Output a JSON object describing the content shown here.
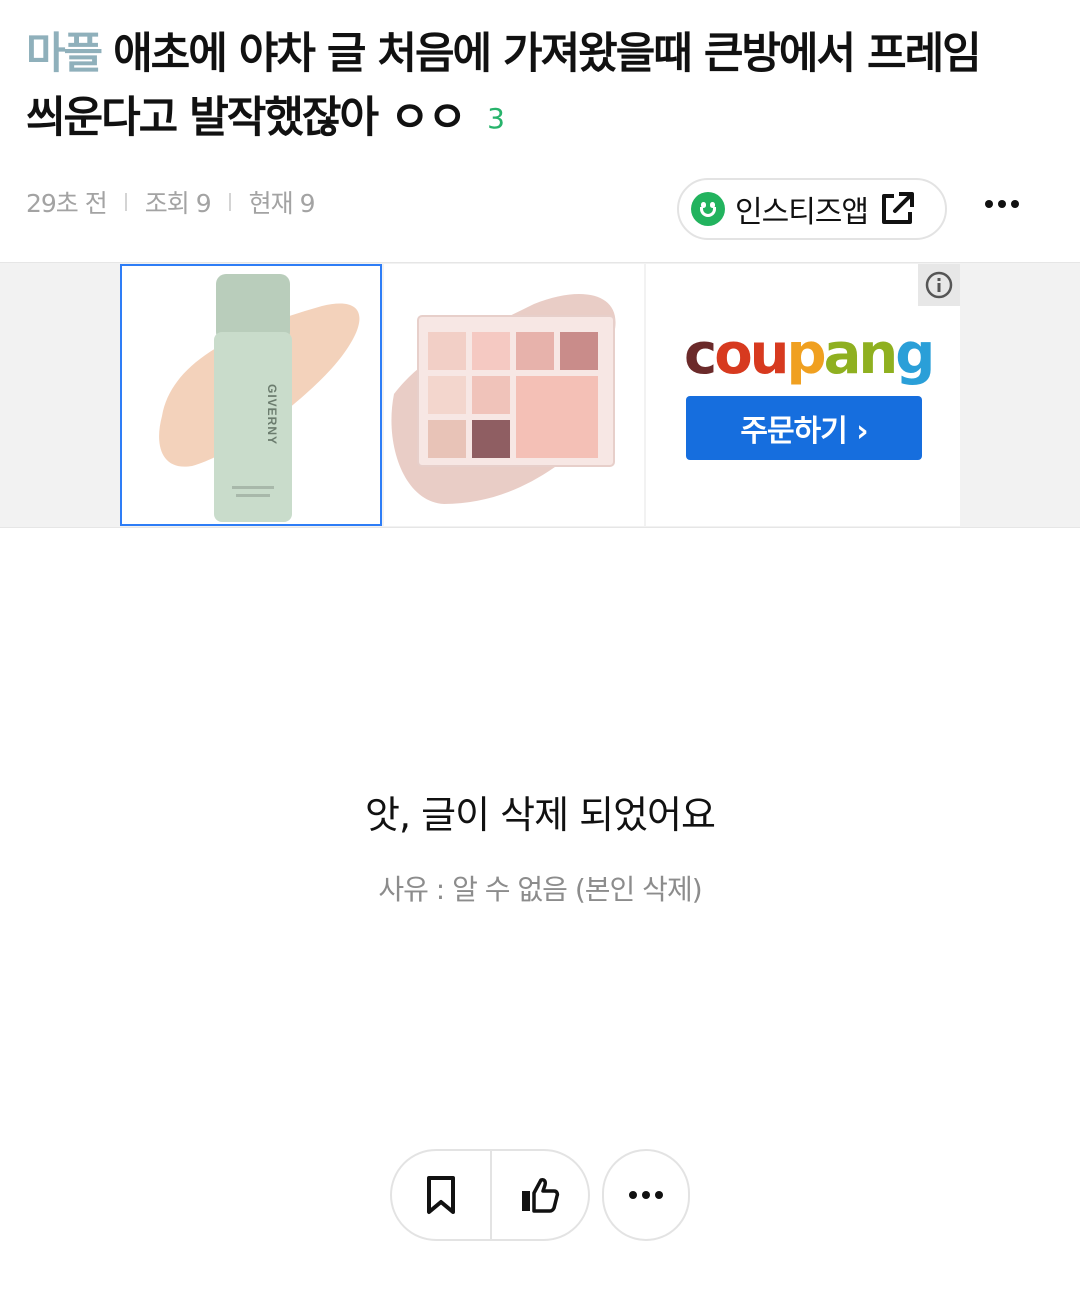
{
  "post": {
    "category": "마플",
    "title": "애초에 야차 글 처음에 가져왔을때 큰방에서 프레임 씌운다고 발작했잖아 ㅇㅇ",
    "comment_count": "3",
    "time": "29초 전",
    "views": "조회 9",
    "current": "현재 9"
  },
  "app_button": {
    "label": "인스티즈앱",
    "icon": "smile-icon",
    "link_icon": "external-link-icon"
  },
  "ad": {
    "brand": "coupang",
    "brand_letters": [
      "c",
      "ou",
      "p",
      "an",
      "g"
    ],
    "order_label": "주문하기 ›",
    "product_1_text": "GIVERNY",
    "colors": {
      "order_button": "#166ede",
      "selected_border": "#2e7df6"
    }
  },
  "deleted": {
    "message": "앗, 글이 삭제 되었어요",
    "reason": "사유 : 알 수 없음 (본인 삭제)"
  },
  "colors": {
    "category": "#8fb0bb",
    "comment_count": "#27b36b",
    "app_icon": "#22b35e"
  }
}
